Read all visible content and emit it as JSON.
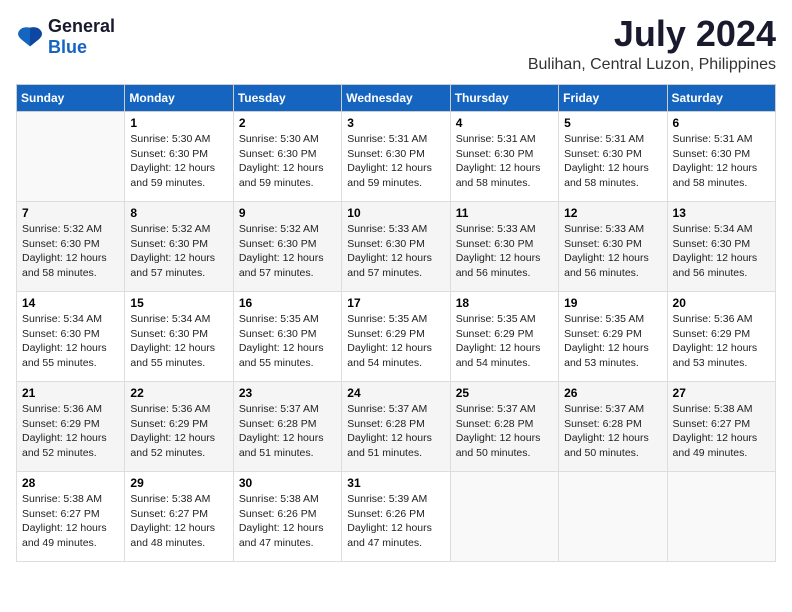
{
  "header": {
    "logo_general": "General",
    "logo_blue": "Blue",
    "month": "July 2024",
    "location": "Bulihan, Central Luzon, Philippines"
  },
  "days_of_week": [
    "Sunday",
    "Monday",
    "Tuesday",
    "Wednesday",
    "Thursday",
    "Friday",
    "Saturday"
  ],
  "weeks": [
    [
      {
        "day": "",
        "info": ""
      },
      {
        "day": "1",
        "info": "Sunrise: 5:30 AM\nSunset: 6:30 PM\nDaylight: 12 hours\nand 59 minutes."
      },
      {
        "day": "2",
        "info": "Sunrise: 5:30 AM\nSunset: 6:30 PM\nDaylight: 12 hours\nand 59 minutes."
      },
      {
        "day": "3",
        "info": "Sunrise: 5:31 AM\nSunset: 6:30 PM\nDaylight: 12 hours\nand 59 minutes."
      },
      {
        "day": "4",
        "info": "Sunrise: 5:31 AM\nSunset: 6:30 PM\nDaylight: 12 hours\nand 58 minutes."
      },
      {
        "day": "5",
        "info": "Sunrise: 5:31 AM\nSunset: 6:30 PM\nDaylight: 12 hours\nand 58 minutes."
      },
      {
        "day": "6",
        "info": "Sunrise: 5:31 AM\nSunset: 6:30 PM\nDaylight: 12 hours\nand 58 minutes."
      }
    ],
    [
      {
        "day": "7",
        "info": "Sunrise: 5:32 AM\nSunset: 6:30 PM\nDaylight: 12 hours\nand 58 minutes."
      },
      {
        "day": "8",
        "info": "Sunrise: 5:32 AM\nSunset: 6:30 PM\nDaylight: 12 hours\nand 57 minutes."
      },
      {
        "day": "9",
        "info": "Sunrise: 5:32 AM\nSunset: 6:30 PM\nDaylight: 12 hours\nand 57 minutes."
      },
      {
        "day": "10",
        "info": "Sunrise: 5:33 AM\nSunset: 6:30 PM\nDaylight: 12 hours\nand 57 minutes."
      },
      {
        "day": "11",
        "info": "Sunrise: 5:33 AM\nSunset: 6:30 PM\nDaylight: 12 hours\nand 56 minutes."
      },
      {
        "day": "12",
        "info": "Sunrise: 5:33 AM\nSunset: 6:30 PM\nDaylight: 12 hours\nand 56 minutes."
      },
      {
        "day": "13",
        "info": "Sunrise: 5:34 AM\nSunset: 6:30 PM\nDaylight: 12 hours\nand 56 minutes."
      }
    ],
    [
      {
        "day": "14",
        "info": "Sunrise: 5:34 AM\nSunset: 6:30 PM\nDaylight: 12 hours\nand 55 minutes."
      },
      {
        "day": "15",
        "info": "Sunrise: 5:34 AM\nSunset: 6:30 PM\nDaylight: 12 hours\nand 55 minutes."
      },
      {
        "day": "16",
        "info": "Sunrise: 5:35 AM\nSunset: 6:30 PM\nDaylight: 12 hours\nand 55 minutes."
      },
      {
        "day": "17",
        "info": "Sunrise: 5:35 AM\nSunset: 6:29 PM\nDaylight: 12 hours\nand 54 minutes."
      },
      {
        "day": "18",
        "info": "Sunrise: 5:35 AM\nSunset: 6:29 PM\nDaylight: 12 hours\nand 54 minutes."
      },
      {
        "day": "19",
        "info": "Sunrise: 5:35 AM\nSunset: 6:29 PM\nDaylight: 12 hours\nand 53 minutes."
      },
      {
        "day": "20",
        "info": "Sunrise: 5:36 AM\nSunset: 6:29 PM\nDaylight: 12 hours\nand 53 minutes."
      }
    ],
    [
      {
        "day": "21",
        "info": "Sunrise: 5:36 AM\nSunset: 6:29 PM\nDaylight: 12 hours\nand 52 minutes."
      },
      {
        "day": "22",
        "info": "Sunrise: 5:36 AM\nSunset: 6:29 PM\nDaylight: 12 hours\nand 52 minutes."
      },
      {
        "day": "23",
        "info": "Sunrise: 5:37 AM\nSunset: 6:28 PM\nDaylight: 12 hours\nand 51 minutes."
      },
      {
        "day": "24",
        "info": "Sunrise: 5:37 AM\nSunset: 6:28 PM\nDaylight: 12 hours\nand 51 minutes."
      },
      {
        "day": "25",
        "info": "Sunrise: 5:37 AM\nSunset: 6:28 PM\nDaylight: 12 hours\nand 50 minutes."
      },
      {
        "day": "26",
        "info": "Sunrise: 5:37 AM\nSunset: 6:28 PM\nDaylight: 12 hours\nand 50 minutes."
      },
      {
        "day": "27",
        "info": "Sunrise: 5:38 AM\nSunset: 6:27 PM\nDaylight: 12 hours\nand 49 minutes."
      }
    ],
    [
      {
        "day": "28",
        "info": "Sunrise: 5:38 AM\nSunset: 6:27 PM\nDaylight: 12 hours\nand 49 minutes."
      },
      {
        "day": "29",
        "info": "Sunrise: 5:38 AM\nSunset: 6:27 PM\nDaylight: 12 hours\nand 48 minutes."
      },
      {
        "day": "30",
        "info": "Sunrise: 5:38 AM\nSunset: 6:26 PM\nDaylight: 12 hours\nand 47 minutes."
      },
      {
        "day": "31",
        "info": "Sunrise: 5:39 AM\nSunset: 6:26 PM\nDaylight: 12 hours\nand 47 minutes."
      },
      {
        "day": "",
        "info": ""
      },
      {
        "day": "",
        "info": ""
      },
      {
        "day": "",
        "info": ""
      }
    ]
  ]
}
